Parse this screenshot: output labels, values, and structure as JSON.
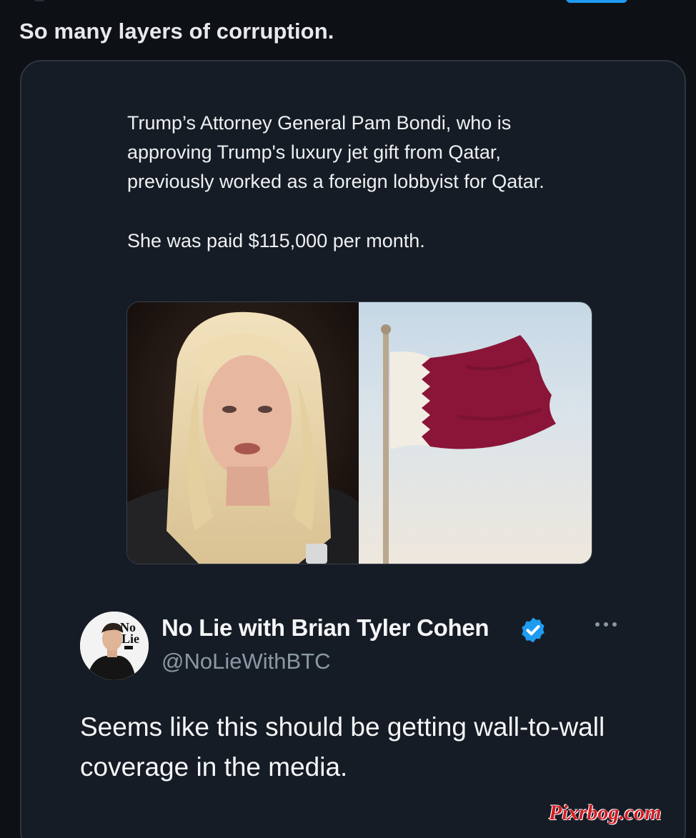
{
  "post": {
    "text": "So many layers of corruption."
  },
  "quote": {
    "paragraph1": "Trump’s Attorney General Pam Bondi, who is approving Trump's luxury jet gift from Qatar, previously worked as a foreign lobbyist for Qatar.",
    "paragraph2": "She was paid $115,000 per month.",
    "media": {
      "left_image": "portrait-photo",
      "right_image": "qatar-flag-photo"
    }
  },
  "author": {
    "name": "No Lie with Brian Tyler Cohen",
    "handle": "@NoLieWithBTC",
    "avatar_text_line1": "No",
    "avatar_text_line2": "Lie",
    "verified": true
  },
  "inner_post": {
    "text": "Seems like this should be getting wall-to-wall coverage in the media."
  },
  "watermark": {
    "text": "Pixrbog.com"
  },
  "colors": {
    "background": "#0d1116",
    "card": "#161c25",
    "accent": "#1d9bf0",
    "watermark": "#d11d25",
    "flag_maroon": "#8a1538"
  },
  "icons": {
    "verified": "verified-badge-icon",
    "more": "more-options-icon"
  }
}
